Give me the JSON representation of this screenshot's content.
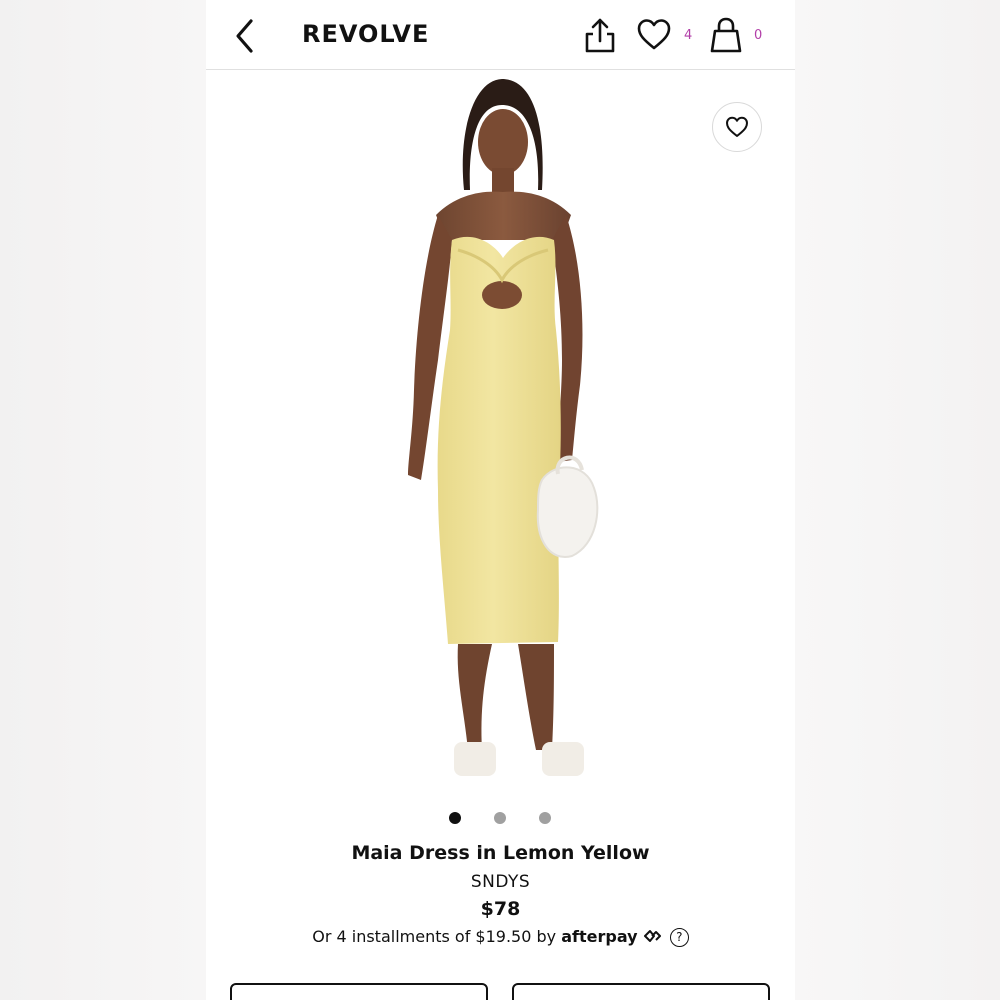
{
  "header": {
    "logo": "REVOLVE",
    "wishlist_count": "4",
    "bag_count": "0"
  },
  "carousel": {
    "total": 3,
    "active": 1
  },
  "product": {
    "name": "Maia Dress in Lemon Yellow",
    "brand": "SNDYS",
    "price": "$78",
    "installments_text": "Or 4 installments of $19.50 by",
    "afterpay_label": "afterpay",
    "help_symbol": "?"
  },
  "colors": {
    "accent_count": "#b23fa8",
    "dress": "#efe297"
  }
}
